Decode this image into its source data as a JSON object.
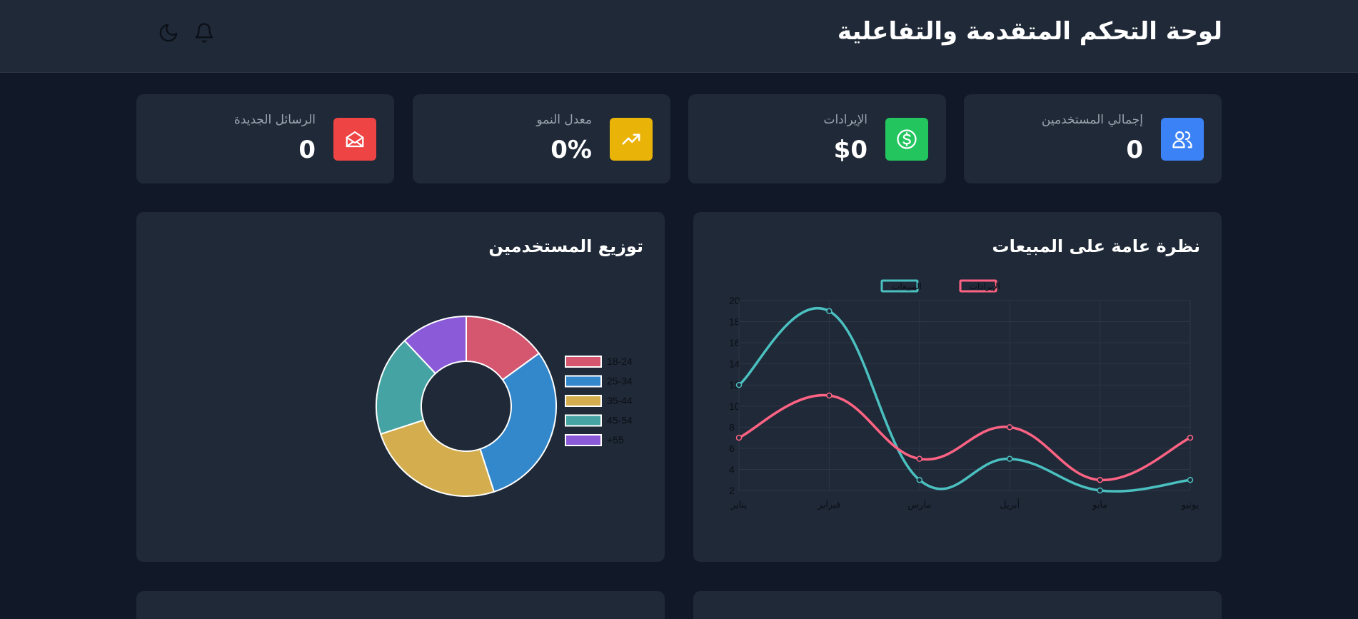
{
  "header": {
    "title": "لوحة التحكم المتقدمة والتفاعلية",
    "icons": [
      "bell-icon",
      "moon-icon"
    ]
  },
  "stats": [
    {
      "label": "إجمالي المستخدمين",
      "value": "0",
      "icon": "users-icon",
      "color": "#3b82f6"
    },
    {
      "label": "الإيرادات",
      "value": "$0",
      "icon": "dollar-icon",
      "color": "#22c55e"
    },
    {
      "label": "معدل النمو",
      "value": "0%",
      "icon": "trending-up-icon",
      "color": "#eab308"
    },
    {
      "label": "الرسائل الجديدة",
      "value": "0",
      "icon": "mail-open-icon",
      "color": "#ef4444"
    }
  ],
  "sales_panel": {
    "title": "نظرة عامة على المبيعات"
  },
  "users_panel": {
    "title": "توزيع المستخدمين"
  },
  "chart_data": [
    {
      "type": "line",
      "title": "نظرة عامة على المبيعات",
      "categories": [
        "يناير",
        "فبراير",
        "مارس",
        "أبريل",
        "مايو",
        "يونيو"
      ],
      "series": [
        {
          "name": "المبيعات",
          "values": [
            12,
            19,
            3,
            5,
            2,
            3
          ],
          "color": "#4bc0c0"
        },
        {
          "name": "الإيرادات",
          "values": [
            7,
            11,
            5,
            8,
            3,
            7
          ],
          "color": "#ff6384"
        }
      ],
      "yticks": [
        2,
        4,
        6,
        8,
        10,
        12,
        14,
        16,
        18,
        20
      ],
      "ylim": [
        2,
        20
      ],
      "grid": true,
      "legend": "top"
    },
    {
      "type": "pie",
      "title": "توزيع المستخدمين",
      "categories": [
        "18-24",
        "25-34",
        "35-44",
        "45-54",
        "+55"
      ],
      "values": [
        15,
        30,
        25,
        18,
        12
      ],
      "colors": [
        "#d4566f",
        "#3388cc",
        "#d4ae4e",
        "#45a3a3",
        "#8a5ad8"
      ],
      "legend": "right"
    }
  ]
}
